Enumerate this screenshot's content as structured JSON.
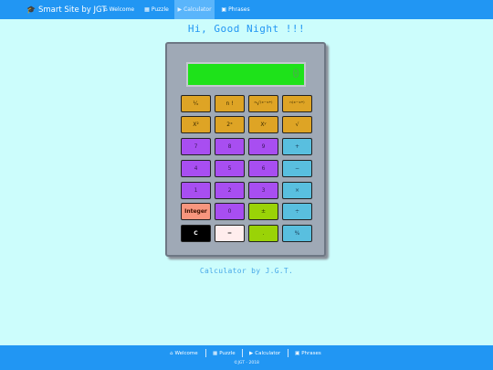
{
  "nav": {
    "brand": "Smart Site by JGT",
    "items": [
      {
        "label": "Welcome",
        "icon": "⌂"
      },
      {
        "label": "Puzzle",
        "icon": "▦"
      },
      {
        "label": "Calculator",
        "icon": "▶"
      },
      {
        "label": "Phrases",
        "icon": "▣"
      }
    ],
    "active": "Calculator"
  },
  "greeting": "Hi, Good Night !!!",
  "calculator": {
    "display": "0",
    "keys": {
      "reciprocal": "¹⁄ₓ",
      "factorial": "n !",
      "root_range": "ⁿ√⁽ˣ⁻ˣᐩ⁾",
      "power_range": "ⁿ⁽ˣ⁻ˣᐩ⁾",
      "square": "X²",
      "pow2": "2ˣ",
      "power_y": "Xʸ",
      "sqrt": "√",
      "seven": "7",
      "eight": "8",
      "nine": "9",
      "plus": "+",
      "four": "4",
      "five": "5",
      "six": "6",
      "minus": "−",
      "one": "1",
      "two": "2",
      "three": "3",
      "multiply": "×",
      "integer": "Integer",
      "zero": "0",
      "plus_minus": "±",
      "divide": "÷",
      "clear": "C",
      "equals": "=",
      "dot": ".",
      "percent": "%"
    }
  },
  "credit": "Calculator by J.G.T.",
  "footer": {
    "links": [
      {
        "label": "Welcome",
        "icon": "⌂"
      },
      {
        "label": "Puzzle",
        "icon": "▦"
      },
      {
        "label": "Calculator",
        "icon": "▶"
      },
      {
        "label": "Phrases",
        "icon": "▣"
      }
    ],
    "copyright": "©JGT - 2018"
  },
  "colors": {
    "brand_blue": "#2196f3",
    "page_bg": "#ccfdfc",
    "display_green": "#1ee21a"
  }
}
